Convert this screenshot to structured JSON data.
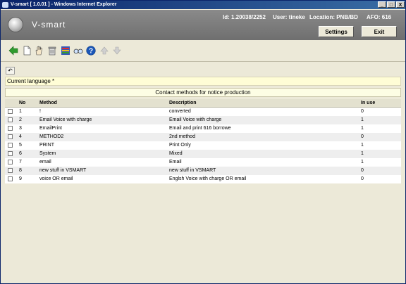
{
  "window": {
    "title": "V-smart [ 1.0.01 ] - Windows Internet Explorer",
    "min": "_",
    "max": "□",
    "close": "X"
  },
  "header": {
    "logo_text": "V-smart",
    "id_label": "Id: 1.20038/2252",
    "user_label": "User: tineke",
    "location_label": "Location: PNB/BD",
    "afo_label": "AFO: 616",
    "settings_label": "Settings",
    "exit_label": "Exit"
  },
  "toolbar": {
    "icons": [
      "back-arrow-icon",
      "new-document-icon",
      "select-hand-icon",
      "delete-trash-icon",
      "options-icon",
      "glasses-view-icon",
      "help-icon",
      "arrow-up-icon",
      "arrow-down-icon"
    ]
  },
  "content": {
    "undo_glyph": "↶",
    "language_label": "Current language *",
    "caption": "Contact methods for notice production"
  },
  "table": {
    "columns": {
      "no": "No",
      "method": "Method",
      "description": "Description",
      "in_use": "In use"
    },
    "rows": [
      {
        "no": "1",
        "method": "!",
        "description": "converted",
        "in_use": "0"
      },
      {
        "no": "2",
        "method": "Email Voice with charge",
        "description": "Email Voice with charge",
        "in_use": "1"
      },
      {
        "no": "3",
        "method": "EmailPrint",
        "description": "Email and print 616 borrowe",
        "in_use": "1"
      },
      {
        "no": "4",
        "method": "METHOD2",
        "description": "2nd method",
        "in_use": "0"
      },
      {
        "no": "5",
        "method": "PRINT",
        "description": "Print Only",
        "in_use": "1"
      },
      {
        "no": "6",
        "method": "System",
        "description": "Mixed",
        "in_use": "1"
      },
      {
        "no": "7",
        "method": "email",
        "description": "Email",
        "in_use": "1"
      },
      {
        "no": "8",
        "method": "new stuff in VSMART",
        "description": "new stuff in VSMART",
        "in_use": "0"
      },
      {
        "no": "9",
        "method": "voice OR email",
        "description": "Englsh Voice with charge OR email",
        "in_use": "0"
      }
    ]
  },
  "colors": {
    "titlebar": "#0a246a",
    "header": "#7a7a7a",
    "panel": "#ece9d8",
    "language_bar": "#fffdd6"
  }
}
